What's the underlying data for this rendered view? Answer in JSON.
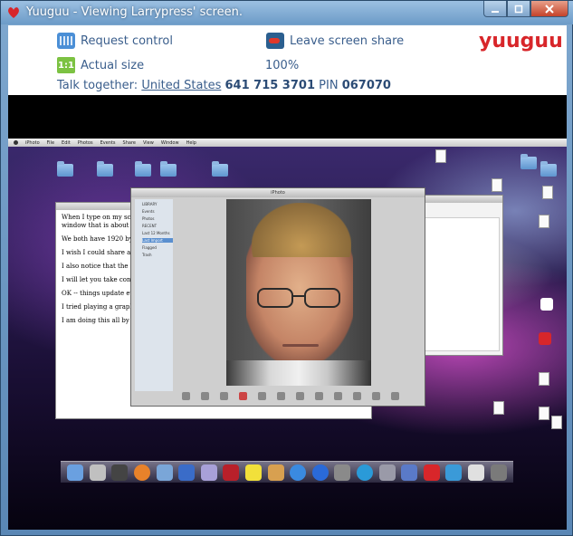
{
  "window": {
    "title": "Yuuguu - Viewing Larrypress' screen."
  },
  "panel": {
    "request_control": "Request control",
    "leave_share": "Leave screen share",
    "actual_size": "Actual size",
    "actual_size_icon": "1:1",
    "zoom_percent": "100%",
    "brand": "yuuguu",
    "talk_label": "Talk together:",
    "talk_country": "United States",
    "talk_number": "641 715 3701",
    "talk_pin_label": "PIN",
    "talk_pin": "067070"
  },
  "remote": {
    "menubar_items": [
      "iPhoto",
      "File",
      "Edit",
      "Photos",
      "Events",
      "Share",
      "View",
      "Window",
      "Help"
    ],
    "textedit_paragraphs": [
      "When I type on my screen, it appears immediately on your screen. Receiving ... for a window that is about ... small, it is only about the",
      "We both have 1920 by ... would go faster if we ha... to see so much stuff.",
      "I wish I could share a si... and more focused",
      "I also notice that the des... screen -- the palette is fa",
      "I will let you take contro",
      "OK -- things update ever... reflect back on mine.",
      "I tried playing a graphic",
      "I am doing this all by my... people to work together"
    ],
    "iphoto_title": "iPhoto",
    "iphoto_sidebar": [
      "LIBRARY",
      "Events",
      "Photos",
      "RECENT",
      "Last 12 Months",
      "Last Import",
      "Flagged",
      "Trash"
    ],
    "iphoto_sidebar_selected": 5
  },
  "colors": {
    "panel_text": "#3a5e8c",
    "brand_red": "#d8262a",
    "close_red": "#c5432a"
  }
}
